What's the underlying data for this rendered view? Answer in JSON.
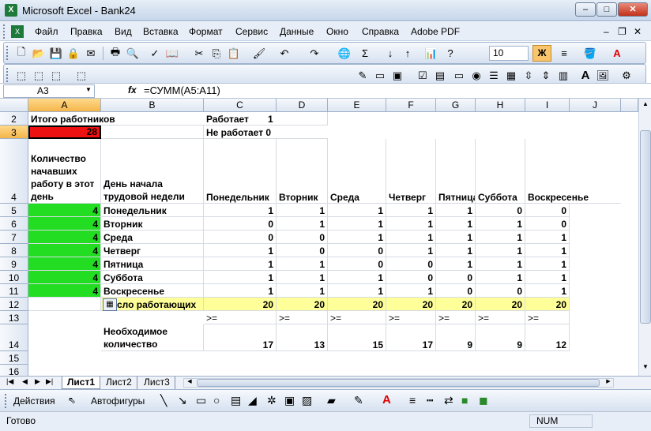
{
  "window": {
    "title": "Microsoft Excel - Bank24",
    "minimize": "–",
    "maximize": "□",
    "close": "✕"
  },
  "menu": [
    "Файл",
    "Правка",
    "Вид",
    "Вставка",
    "Формат",
    "Сервис",
    "Данные",
    "Окно",
    "Справка",
    "Adobe PDF"
  ],
  "toolbar": {
    "font_size": "10",
    "bold": "Ж"
  },
  "formula_bar": {
    "name_box": "A3",
    "fx": "fx",
    "formula": "=СУММ(A5:A11)"
  },
  "columns": [
    "A",
    "B",
    "C",
    "D",
    "E",
    "F",
    "G",
    "H",
    "I",
    "J"
  ],
  "rows": [
    "2",
    "3",
    "4",
    "5",
    "6",
    "7",
    "8",
    "9",
    "10",
    "11",
    "12",
    "13",
    "14",
    "15",
    "16"
  ],
  "cells": {
    "a2": "Итого работников",
    "c2": "Работает",
    "d2": "1",
    "a3": "28",
    "c3": "Не работает 0",
    "a4": "Количество начавших работу в этот день",
    "b4": "День начала трудовой недели",
    "h4": [
      "Понедельник",
      "Вторник",
      "Среда",
      "Четверг",
      "Пятница",
      "Суббота",
      "Воскресенье"
    ],
    "days": [
      "Понедельник",
      "Вторник",
      "Среда",
      "Четверг",
      "Пятница",
      "Суббота",
      "Воскресенье"
    ],
    "a_vals": [
      "4",
      "4",
      "4",
      "4",
      "4",
      "4",
      "4"
    ],
    "matrix": [
      [
        "1",
        "1",
        "1",
        "1",
        "1",
        "0",
        "0"
      ],
      [
        "0",
        "1",
        "1",
        "1",
        "1",
        "1",
        "0"
      ],
      [
        "0",
        "0",
        "1",
        "1",
        "1",
        "1",
        "1"
      ],
      [
        "1",
        "0",
        "0",
        "1",
        "1",
        "1",
        "1"
      ],
      [
        "1",
        "1",
        "0",
        "0",
        "1",
        "1",
        "1"
      ],
      [
        "1",
        "1",
        "1",
        "0",
        "0",
        "1",
        "1"
      ],
      [
        "1",
        "1",
        "1",
        "1",
        "0",
        "0",
        "1"
      ]
    ],
    "b12": "сло работающих",
    "row12": [
      "20",
      "20",
      "20",
      "20",
      "20",
      "20",
      "20"
    ],
    "row13": [
      ">=",
      ">=",
      ">=",
      ">=",
      ">=",
      ">=",
      ">="
    ],
    "b14": "Необходимое количество",
    "row14": [
      "17",
      "13",
      "15",
      "17",
      "9",
      "9",
      "12"
    ]
  },
  "sheets": [
    "Лист1",
    "Лист2",
    "Лист3"
  ],
  "drawbar": {
    "actions": "Действия",
    "autoshapes": "Автофигуры"
  },
  "status": {
    "ready": "Готово",
    "num": "NUM"
  }
}
